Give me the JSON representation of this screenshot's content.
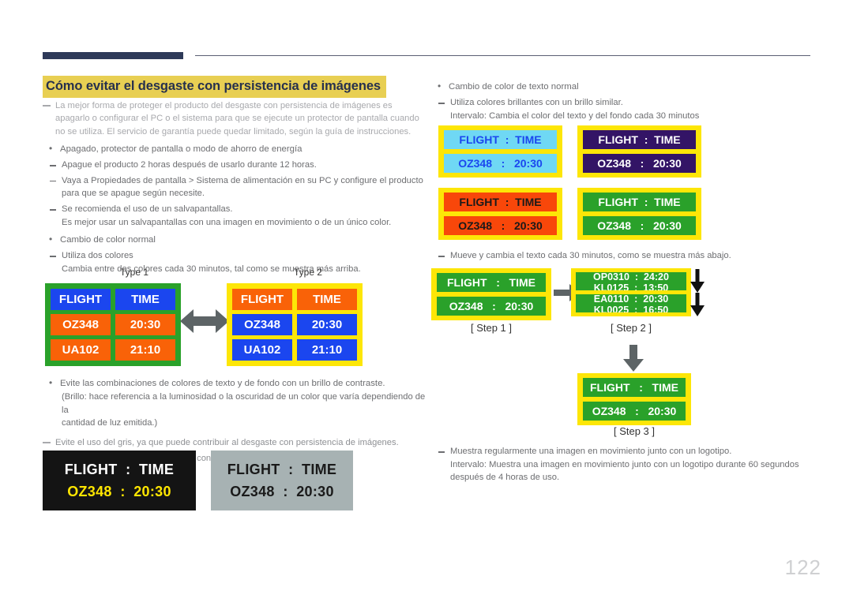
{
  "page": {
    "number": "122"
  },
  "title": "Cómo evitar el desgaste con persistencia de imágenes",
  "left": {
    "intro_note": "La mejor forma de proteger el producto del desgaste con persistencia de imágenes es apagarlo o configurar el PC o el sistema para que se ejecute un protector de pantalla cuando no se utiliza. El servicio de garantía puede quedar limitado, según la guía de instrucciones.",
    "bullet1": "Apagado, protector de pantalla o modo de ahorro de energía",
    "b1_sub1": "Apague el producto 2 horas después de usarlo durante 12 horas.",
    "b1_sub2": "Vaya a Propiedades de pantalla > Sistema de alimentación en su PC y configure el producto para que se apague según necesite.",
    "b1_sub3": "Se recomienda el uso de un salvapantallas.",
    "b1_sub3_detail": "Es mejor usar un salvapantallas con una imagen en movimiento o de un único color.",
    "bullet2": "Cambio de color normal",
    "b2_sub1": "Utiliza dos colores",
    "b2_sub1_detail": "Cambia entre dos colores cada 30 minutos, tal como se muestra más arriba.",
    "type1_label": "Type 1",
    "type2_label": "Type 2",
    "bullet3": "Evite las combinaciones de colores de texto y de fondo con un brillo de contraste.",
    "bullet3_detail1": "(Brillo: hace referencia a la luminosidad o la oscuridad de un color que varía dependiendo de la",
    "bullet3_detail2": "cantidad de luz emitida.)",
    "note2": "Evite el uso del gris, ya que puede contribuir al desgaste con persistencia de imágenes.",
    "note3": "Evite el uso de colores de brillo con contraste (blanco y negro; gris)."
  },
  "right": {
    "bullet1": "Cambio de color de texto normal",
    "b1_sub1": "Utiliza colores brillantes con un brillo similar.",
    "b1_sub1_detail": "Intervalo: Cambia el color del texto y del fondo cada 30 minutos",
    "b2_sub1": "Mueve y cambia el texto cada 30 minutos, como se muestra más abajo.",
    "step1_label": "[ Step 1 ]",
    "step2_label": "[ Step 2 ]",
    "step3_label": "[ Step 3 ]",
    "bullet3": "Muestra regularmente una imagen en movimiento junto con un logotipo.",
    "bullet3_detail1": "Intervalo: Muestra una imagen en movimiento junto con un logotipo durante 60 segundos",
    "bullet3_detail2": "después de 4 horas de uso."
  },
  "boards": {
    "type1": {
      "header": [
        "FLIGHT",
        "TIME"
      ],
      "rows": [
        [
          "OZ348",
          "20:30"
        ],
        [
          "UA102",
          "21:10"
        ]
      ]
    },
    "type2": {
      "header": [
        "FLIGHT",
        "TIME"
      ],
      "rows": [
        [
          "OZ348",
          "20:30"
        ],
        [
          "UA102",
          "21:10"
        ]
      ]
    },
    "contrast_black": {
      "line1": "FLIGHT  :  TIME",
      "line2": "OZ348  :  20:30"
    },
    "contrast_gray": {
      "line1": "FLIGHT  :  TIME",
      "line2": "OZ348  :  20:30"
    },
    "color_pairs": [
      {
        "name": "light-blue",
        "line1": "FLIGHT  :  TIME",
        "line2": "OZ348   :   20:30"
      },
      {
        "name": "dark-purple",
        "line1": "FLIGHT  :  TIME",
        "line2": "OZ348   :   20:30"
      },
      {
        "name": "orange",
        "line1": "FLIGHT  :  TIME",
        "line2": "OZ348   :   20:30"
      },
      {
        "name": "green",
        "line1": "FLIGHT  :  TIME",
        "line2": "OZ348   :   20:30"
      }
    ],
    "step1": {
      "line1": "FLIGHT   :   TIME",
      "line2": "OZ348   :   20:30"
    },
    "step2": {
      "strip1_top": "OP0310  :  24:20",
      "strip1_bottom": "KL0125  :  13:50",
      "strip2_top": "EA0110  :  20:30",
      "strip2_bottom": "KL0025  :  16:50"
    },
    "step3": {
      "line1": "FLIGHT   :   TIME",
      "line2": "OZ348   :   20:30"
    }
  },
  "colors": {
    "highlight": "#e8cf53",
    "navy": "#2e3a59",
    "green": "#2aa12a",
    "yellow": "#fde607",
    "blue": "#1b46ef",
    "orange": "#f96208",
    "purple": "#331466",
    "lightblue": "#6fd8f4",
    "arrow_gray": "#5d6466"
  }
}
